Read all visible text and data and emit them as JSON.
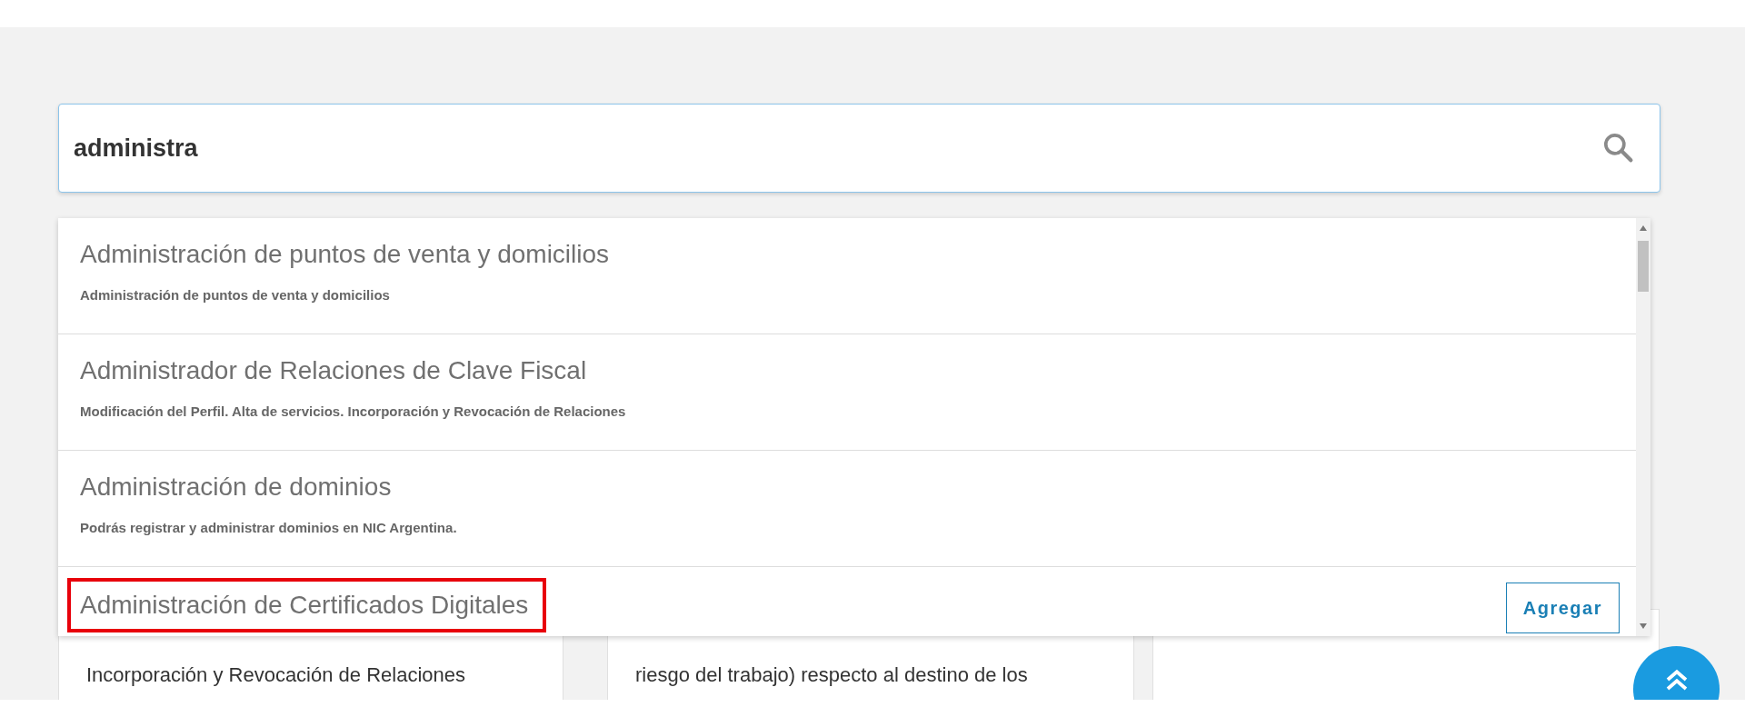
{
  "search": {
    "value": "administra"
  },
  "results": [
    {
      "title": "Administración de puntos de venta y domicilios",
      "description": "Administración de puntos de venta y domicilios",
      "highlighted": false
    },
    {
      "title": "Administrador de Relaciones de Clave Fiscal",
      "description": "Modificación del Perfil. Alta de servicios. Incorporación y Revocación de Relaciones",
      "highlighted": false
    },
    {
      "title": "Administración de dominios",
      "description": "Podrás registrar y administrar dominios en NIC Argentina.",
      "highlighted": false
    },
    {
      "title": "Administración de Certificados Digitales",
      "highlighted": true,
      "action": "Agregar"
    }
  ],
  "cards": [
    {
      "kind": "card",
      "text": "Incorporación y Revocación de Relaciones"
    },
    {
      "kind": "card",
      "text": "riesgo del trabajo) respecto al destino de los"
    },
    {
      "kind": "card"
    }
  ]
}
